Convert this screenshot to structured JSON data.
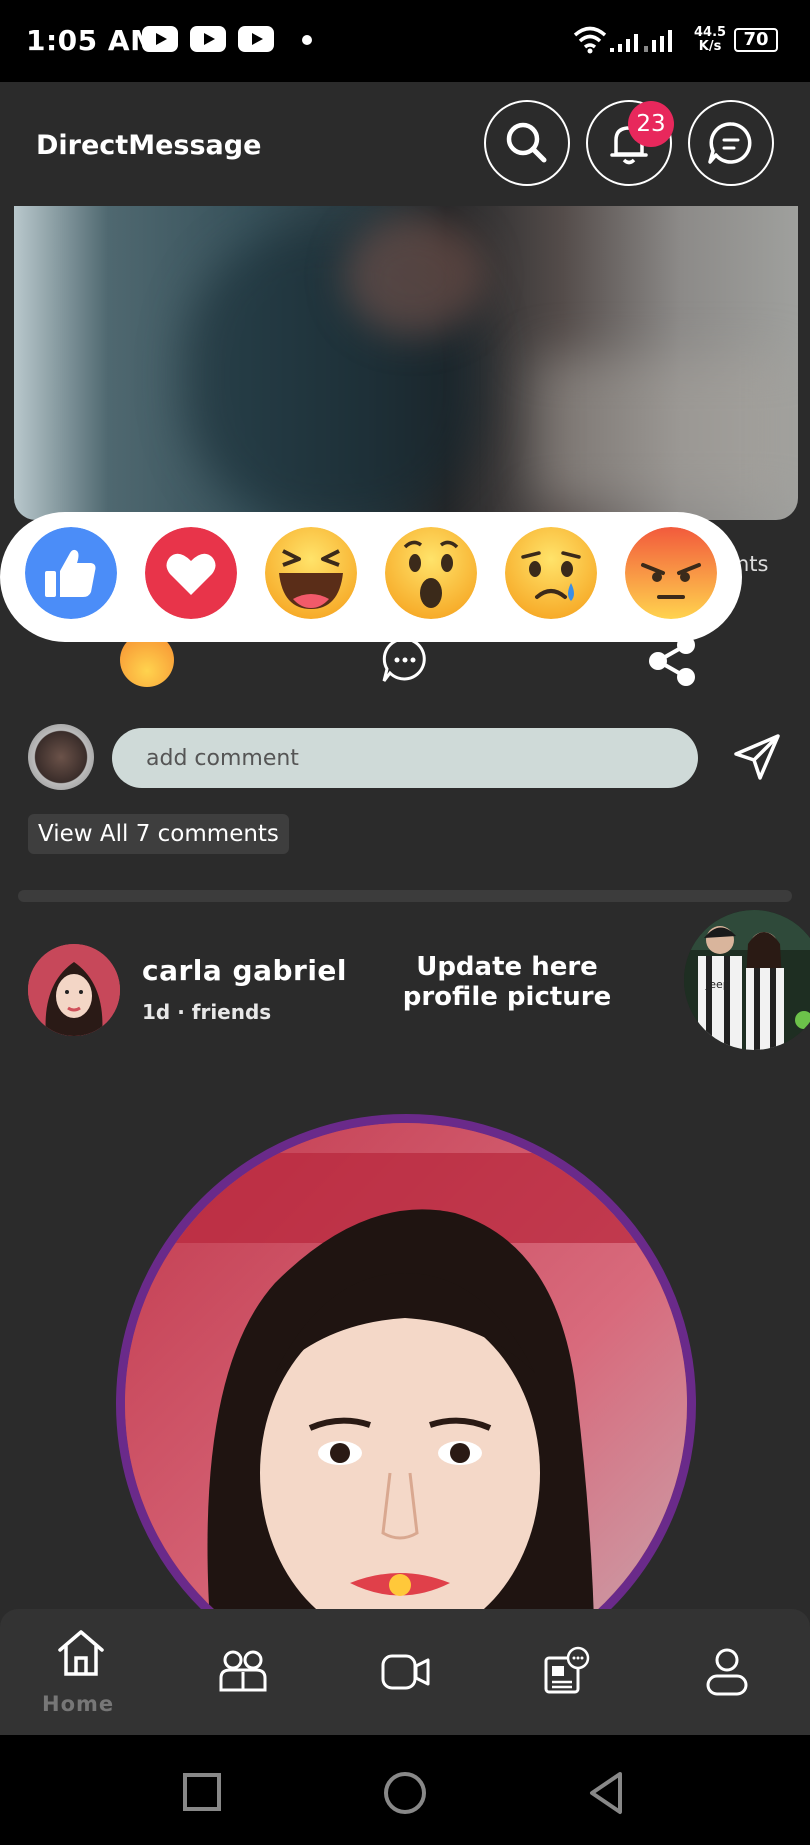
{
  "status_bar": {
    "time": "1:05 AM",
    "speed_value": "44.5",
    "speed_unit": "K/s",
    "battery": "70",
    "icons": [
      "youtube-icon",
      "youtube-icon",
      "youtube-icon",
      "wifi-icon",
      "signal-icon"
    ]
  },
  "header": {
    "title": "DirectMessage",
    "notification_count": "23",
    "icons": [
      "search-icon",
      "bell-icon",
      "chat-icon"
    ]
  },
  "post": {
    "comments_peek": "nts",
    "reactions": [
      "like-reaction",
      "love-reaction",
      "haha-reaction",
      "wow-reaction",
      "sad-reaction",
      "angry-reaction"
    ],
    "comment_placeholder": "add comment",
    "view_all": "View All 7 comments"
  },
  "second_post": {
    "name": "carla gabriel",
    "meta": "1d · friends",
    "update_text": "Update here profile picture",
    "side_photo_text": "Jeep"
  },
  "bottom_nav": {
    "items": [
      "home-icon",
      "friends-icon",
      "video-icon",
      "news-icon",
      "profile-icon"
    ],
    "home_label": "Home"
  },
  "colors": {
    "background": "#2b2b2b",
    "badge": "#e8285c",
    "like_blue": "#4b8df8",
    "love_red": "#e8344a",
    "profile_ring": "#6a2a8a"
  }
}
